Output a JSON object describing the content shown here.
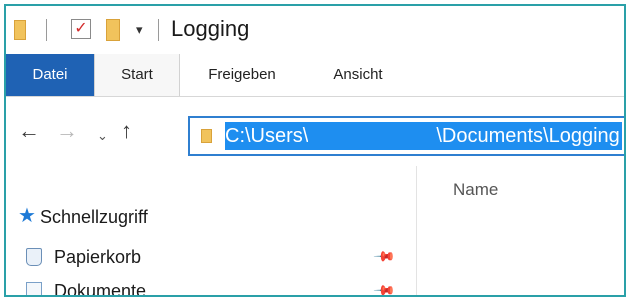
{
  "window": {
    "title": "Logging",
    "quick_access": {
      "check_glyph": "✓",
      "dropdown_glyph": "▾"
    }
  },
  "ribbon": {
    "tabs": [
      {
        "label": "Datei"
      },
      {
        "label": "Start"
      },
      {
        "label": "Freigeben"
      },
      {
        "label": "Ansicht"
      }
    ],
    "file_tab_color": "#1f62b4"
  },
  "navigation": {
    "back_glyph": "←",
    "forward_glyph": "→",
    "recent_glyph": "⌄",
    "up_glyph": "↑"
  },
  "address_bar": {
    "path_start": "C:\\Users\\",
    "path_end": "\\Documents\\Logging",
    "selection_color": "#1e8ef0"
  },
  "file_list": {
    "column_name": "Name"
  },
  "nav_pane": {
    "quick_access_label": "Schnellzugriff",
    "items": [
      {
        "label": "Papierkorb",
        "icon": "recycle-bin-icon"
      },
      {
        "label": "Dokumente",
        "icon": "documents-icon"
      }
    ]
  }
}
